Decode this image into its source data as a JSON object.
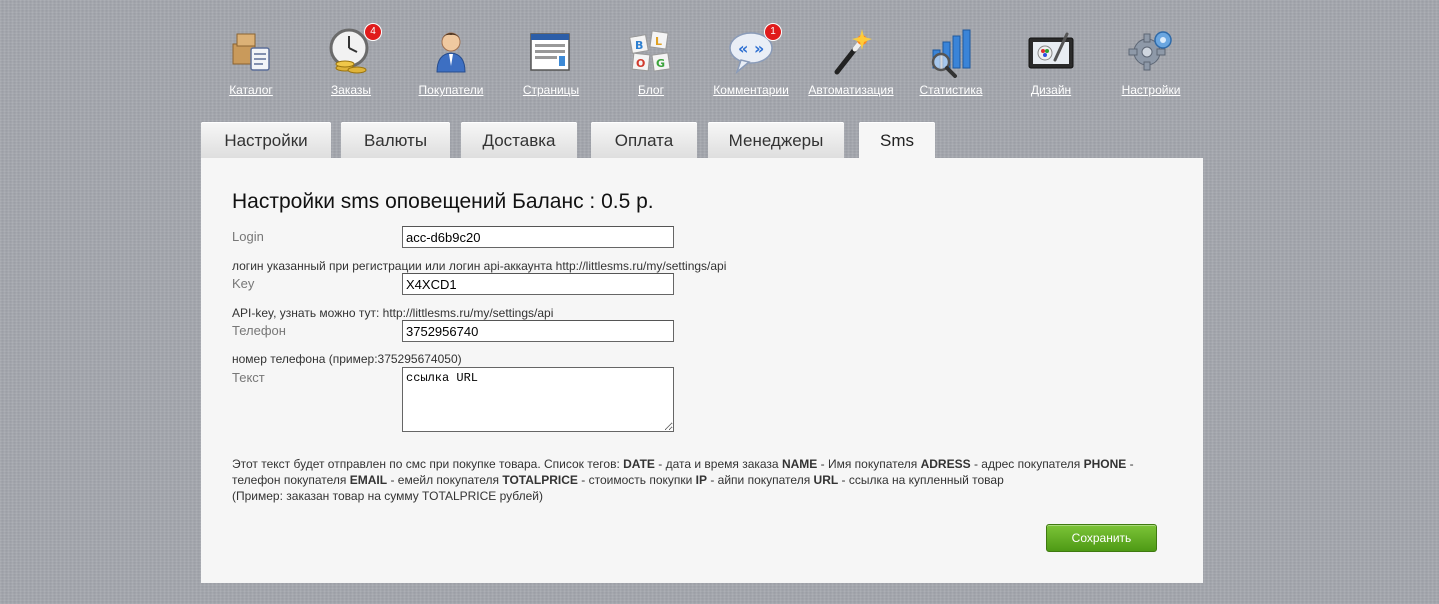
{
  "nav": {
    "items": [
      {
        "label": "Каталог",
        "icon": "catalog-icon"
      },
      {
        "label": "Заказы",
        "icon": "orders-icon",
        "badge": "4"
      },
      {
        "label": "Покупатели",
        "icon": "customers-icon"
      },
      {
        "label": "Страницы",
        "icon": "pages-icon"
      },
      {
        "label": "Блог",
        "icon": "blog-icon"
      },
      {
        "label": "Комментарии",
        "icon": "comments-icon",
        "badge": "1"
      },
      {
        "label": "Автоматизация",
        "icon": "automation-icon"
      },
      {
        "label": "Статистика",
        "icon": "statistics-icon"
      },
      {
        "label": "Дизайн",
        "icon": "design-icon"
      },
      {
        "label": "Настройки",
        "icon": "settings-icon"
      }
    ]
  },
  "tabs": [
    {
      "label": "Настройки"
    },
    {
      "label": "Валюты"
    },
    {
      "label": "Доставка"
    },
    {
      "label": "Оплата"
    },
    {
      "label": "Менеджеры"
    },
    {
      "label": "Sms",
      "active": true
    }
  ],
  "form": {
    "title": "Настройки sms оповещений Баланс : 0.5 р.",
    "login": {
      "label": "Login",
      "value": "acc-d6b9c20",
      "hint": "логин указанный при регистрации или логин api-аккаунта http://littlesms.ru/my/settings/api"
    },
    "key": {
      "label": "Key",
      "value": "X4XCD1",
      "hint": "API-key, узнать можно тут: http://littlesms.ru/my/settings/api"
    },
    "phone": {
      "label": "Телефон",
      "value": "3752956740",
      "hint": "номер телефона (пример:375295674050)"
    },
    "text": {
      "label": "Текст",
      "value": "ссылка URL"
    },
    "description": {
      "p1": "Этот текст будет отправлен по смс при покупке товара. Список тегов: ",
      "t1": "DATE",
      "p2": " - дата и время заказа ",
      "t2": "NAME",
      "p3": " - Имя покупателя ",
      "t3": "ADRESS",
      "p4": " - адрес покупателя ",
      "t4": "PHONE",
      "p5": " - телефон покупателя ",
      "t5": "EMAIL",
      "p6": " - емейл покупателя ",
      "t6": "TOTALPRICE",
      "p7": " - стоимость покупки ",
      "t7": "IP",
      "p8": " - айпи покупателя ",
      "t8": "URL",
      "p9": " - ссылка на купленный товар",
      "example": "(Пример: заказан товар на сумму TOTALPRICE рублей)"
    },
    "save_label": "Сохранить"
  },
  "colors": {
    "background": "#a3a6ad",
    "panel": "#f6f6f6",
    "badge": "#e01b1b",
    "save_button": "#5faa22"
  }
}
